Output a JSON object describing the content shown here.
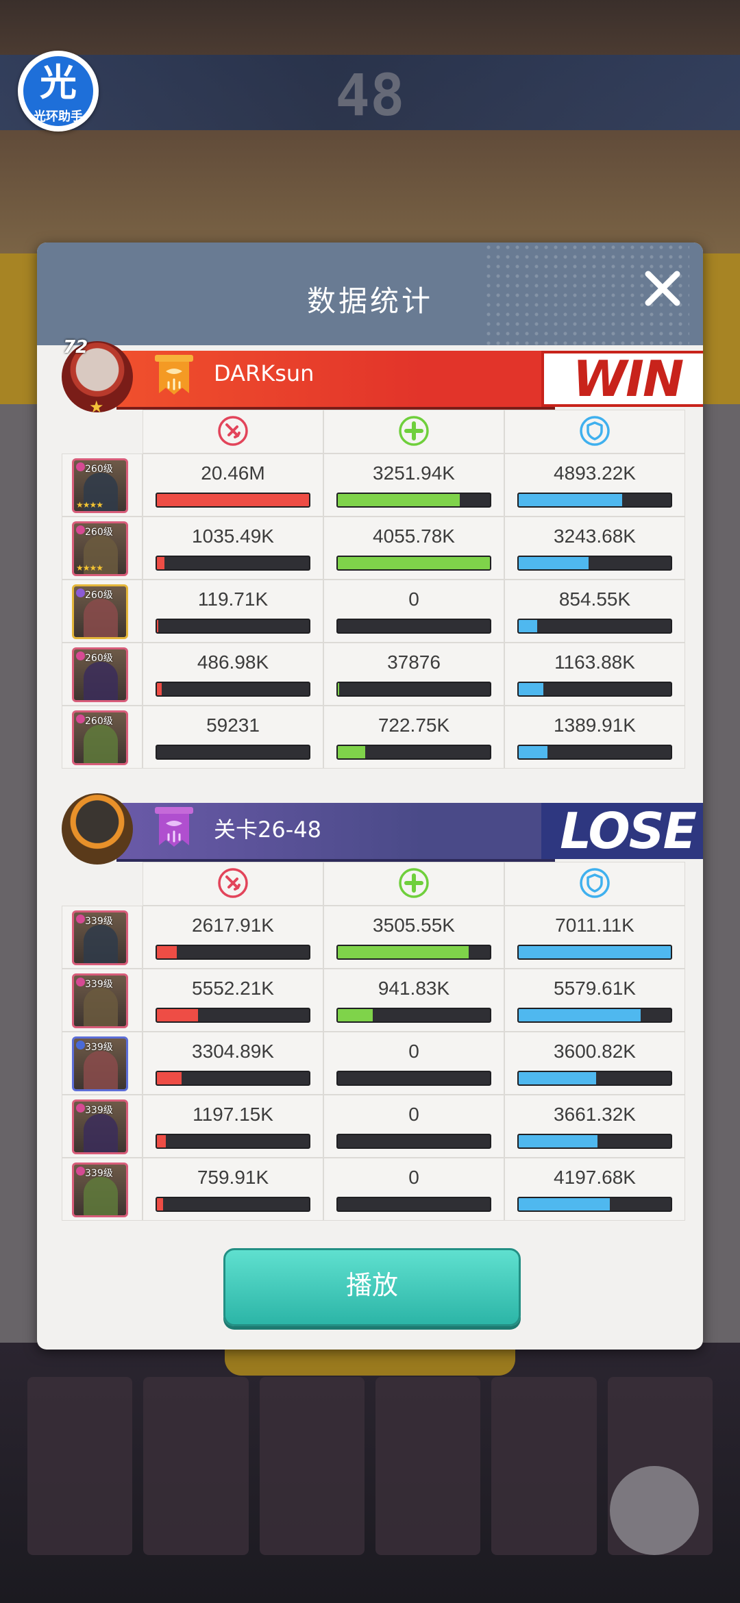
{
  "helper": {
    "char": "光",
    "label": "光环助手"
  },
  "background": {
    "score": "48"
  },
  "dialog": {
    "title": "数据统计",
    "play_label": "播放",
    "stat_icons": [
      "attack-damage-icon",
      "healing-cross-icon",
      "shield-defense-icon"
    ]
  },
  "teams": [
    {
      "name": "DARKsun",
      "level": "72",
      "result": "WIN",
      "heroes": [
        {
          "level": "260级",
          "element": "pink",
          "stars": "★★★★",
          "damage": "20.46M",
          "heal": "3251.94K",
          "tank": "4893.22K",
          "damage_pct": 1.0,
          "heal_pct": 0.8,
          "tank_pct": 0.68
        },
        {
          "level": "260级",
          "element": "pink",
          "stars": "★★★★",
          "damage": "1035.49K",
          "heal": "4055.78K",
          "tank": "3243.68K",
          "damage_pct": 0.05,
          "heal_pct": 1.0,
          "tank_pct": 0.46
        },
        {
          "level": "260级",
          "element": "moon",
          "stars": "",
          "damage": "119.71K",
          "heal": "0",
          "tank": "854.55K",
          "damage_pct": 0.01,
          "heal_pct": 0.0,
          "tank_pct": 0.12
        },
        {
          "level": "260级",
          "element": "pink",
          "stars": "",
          "damage": "486.98K",
          "heal": "37876",
          "tank": "1163.88K",
          "damage_pct": 0.03,
          "heal_pct": 0.01,
          "tank_pct": 0.16
        },
        {
          "level": "260级",
          "element": "pink",
          "stars": "",
          "damage": "59231",
          "heal": "722.75K",
          "tank": "1389.91K",
          "damage_pct": 0.0,
          "heal_pct": 0.18,
          "tank_pct": 0.19
        }
      ]
    },
    {
      "name": "关卡26-48",
      "level": "",
      "result": "LOSE",
      "heroes": [
        {
          "level": "339级",
          "element": "pink",
          "stars": "",
          "damage": "2617.91K",
          "heal": "3505.55K",
          "tank": "7011.11K",
          "damage_pct": 0.13,
          "heal_pct": 0.86,
          "tank_pct": 1.0
        },
        {
          "level": "339级",
          "element": "pink",
          "stars": "",
          "damage": "5552.21K",
          "heal": "941.83K",
          "tank": "5579.61K",
          "damage_pct": 0.27,
          "heal_pct": 0.23,
          "tank_pct": 0.8
        },
        {
          "level": "339级",
          "element": "blue",
          "stars": "",
          "damage": "3304.89K",
          "heal": "0",
          "tank": "3600.82K",
          "damage_pct": 0.16,
          "heal_pct": 0.0,
          "tank_pct": 0.51
        },
        {
          "level": "339级",
          "element": "pink",
          "stars": "",
          "damage": "1197.15K",
          "heal": "0",
          "tank": "3661.32K",
          "damage_pct": 0.06,
          "heal_pct": 0.0,
          "tank_pct": 0.52
        },
        {
          "level": "339级",
          "element": "pink",
          "stars": "",
          "damage": "759.91K",
          "heal": "0",
          "tank": "4197.68K",
          "damage_pct": 0.04,
          "heal_pct": 0.0,
          "tank_pct": 0.6
        }
      ]
    }
  ],
  "colors": {
    "win_bar": "#e2342a",
    "lose_bar": "#4a4a88",
    "damage": "#ee4d45",
    "heal": "#7fd34a",
    "tank": "#4fb8ef",
    "play_button": "#3cc8b8",
    "header": "#697b93"
  }
}
